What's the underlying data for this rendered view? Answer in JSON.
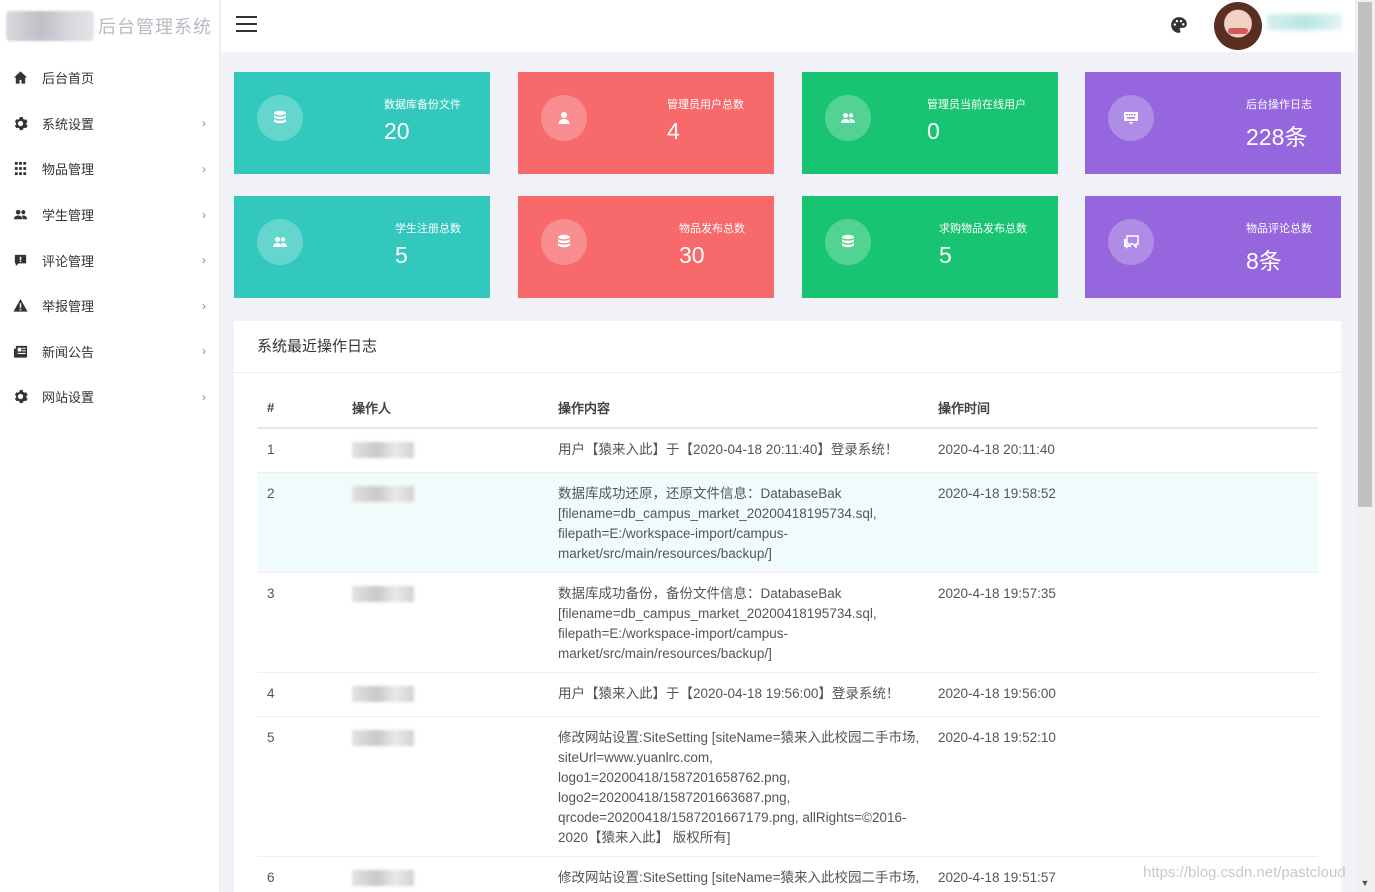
{
  "brand": {
    "title": "后台管理系统"
  },
  "sidebar": {
    "items": [
      {
        "label": "后台首页",
        "icon": "home-icon",
        "has_arrow": false
      },
      {
        "label": "系统设置",
        "icon": "gear-icon",
        "has_arrow": true
      },
      {
        "label": "物品管理",
        "icon": "grid-icon",
        "has_arrow": true
      },
      {
        "label": "学生管理",
        "icon": "users-icon",
        "has_arrow": true
      },
      {
        "label": "评论管理",
        "icon": "comment-icon",
        "has_arrow": true
      },
      {
        "label": "举报管理",
        "icon": "warning-icon",
        "has_arrow": true
      },
      {
        "label": "新闻公告",
        "icon": "newspaper-icon",
        "has_arrow": true
      },
      {
        "label": "网站设置",
        "icon": "gear-icon",
        "has_arrow": true
      }
    ],
    "arrow_glyph": "›"
  },
  "header": {
    "menu_icon": "hamburger-icon",
    "theme_icon": "palette-icon"
  },
  "cards": [
    {
      "label": "数据库备份文件",
      "value": "20",
      "icon": "database-icon",
      "color": "#32c8bd"
    },
    {
      "label": "管理员用户总数",
      "value": "4",
      "icon": "user-icon",
      "color": "#f7696b"
    },
    {
      "label": "管理员当前在线用户",
      "value": "0",
      "icon": "users-icon",
      "color": "#18c471"
    },
    {
      "label": "后台操作日志",
      "value": "228条",
      "icon": "keyboard-icon",
      "color": "#9566dd"
    },
    {
      "label": "学生注册总数",
      "value": "5",
      "icon": "users-icon",
      "color": "#32c8bd"
    },
    {
      "label": "物品发布总数",
      "value": "30",
      "icon": "database-icon",
      "color": "#f7696b"
    },
    {
      "label": "求购物品发布总数",
      "value": "5",
      "icon": "database-icon",
      "color": "#18c471"
    },
    {
      "label": "物品评论总数",
      "value": "8条",
      "icon": "comments-icon",
      "color": "#9566dd"
    }
  ],
  "log": {
    "title": "系统最近操作日志",
    "columns": [
      "#",
      "操作人",
      "操作内容",
      "操作时间"
    ],
    "rows": [
      {
        "id": "1",
        "content": "用户【猿来入此】于【2020-04-18 20:11:40】登录系统！",
        "time": "2020-4-18 20:11:40"
      },
      {
        "id": "2",
        "content": "数据库成功还原，还原文件信息：DatabaseBak [filename=db_campus_market_20200418195734.sql, filepath=E:/workspace-import/campus-market/src/main/resources/backup/]",
        "time": "2020-4-18 19:58:52"
      },
      {
        "id": "3",
        "content": "数据库成功备份，备份文件信息：DatabaseBak [filename=db_campus_market_20200418195734.sql, filepath=E:/workspace-import/campus-market/src/main/resources/backup/]",
        "time": "2020-4-18 19:57:35"
      },
      {
        "id": "4",
        "content": "用户【猿来入此】于【2020-04-18 19:56:00】登录系统！",
        "time": "2020-4-18 19:56:00"
      },
      {
        "id": "5",
        "content": "修改网站设置:SiteSetting [siteName=猿来入此校园二手市场, siteUrl=www.yuanlrc.com, logo1=20200418/1587201658762.png, logo2=20200418/1587201663687.png, qrcode=20200418/1587201667179.png, allRights=©2016-2020【猿来入此】 版权所有]",
        "time": "2020-4-18 19:52:10"
      },
      {
        "id": "6",
        "content": "修改网站设置:SiteSetting [siteName=猿来入此校园二手市场, siteUrl=www.yuanlrc.com,",
        "time": "2020-4-18 19:51:57"
      }
    ]
  },
  "watermark": "https://blog.csdn.net/pastcloud"
}
